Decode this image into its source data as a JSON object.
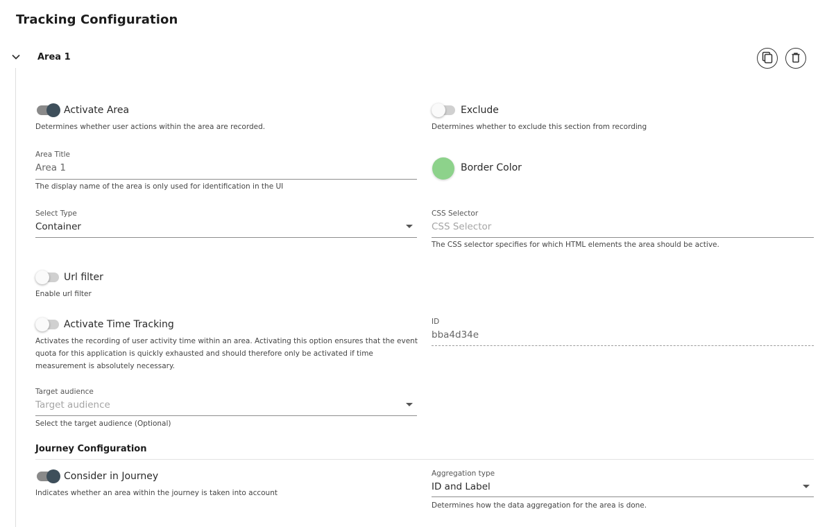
{
  "page": {
    "title": "Tracking Configuration"
  },
  "area": {
    "name": "Area 1"
  },
  "activate_area": {
    "label": "Activate Area",
    "hint": "Determines whether user actions within the area are recorded.",
    "on": true
  },
  "exclude": {
    "label": "Exclude",
    "hint": "Determines whether to exclude this section from recording",
    "on": false
  },
  "area_title": {
    "label": "Area Title",
    "value": "Area 1",
    "hint": "The display name of the area is only used for identification in the UI"
  },
  "border_color": {
    "label": "Border Color",
    "color": "#8dd28b"
  },
  "select_type": {
    "label": "Select Type",
    "value": "Container"
  },
  "css_selector": {
    "label": "CSS Selector",
    "placeholder": "CSS Selector",
    "hint": "The CSS selector specifies for which HTML elements the area should be active."
  },
  "url_filter": {
    "label": "Url filter",
    "hint": "Enable url filter",
    "on": false
  },
  "time_tracking": {
    "label": "Activate Time Tracking",
    "hint": "Activates the recording of user activity time within an area. Activating this option ensures that the event quota for this application is quickly exhausted and should therefore only be activated if time measurement is absolutely necessary.",
    "on": false
  },
  "id_field": {
    "label": "ID",
    "value": "bba4d34e"
  },
  "target_audience": {
    "label": "Target audience",
    "placeholder": "Target audience",
    "hint": "Select the target audience (Optional)"
  },
  "journey": {
    "title": "Journey Configuration",
    "consider": {
      "label": "Consider in Journey",
      "hint": "Indicates whether an area within the journey is taken into account",
      "on": true
    },
    "aggregation": {
      "label": "Aggregation type",
      "value": "ID and Label",
      "hint": "Determines how the data aggregation for the area is done."
    }
  },
  "icons": {
    "collapse": "chevron-down-icon",
    "copy": "copy-icon",
    "delete": "trash-icon"
  },
  "colors": {
    "toggle_on_knob": "#3e4f5b",
    "swatch": "#8dd28b"
  }
}
